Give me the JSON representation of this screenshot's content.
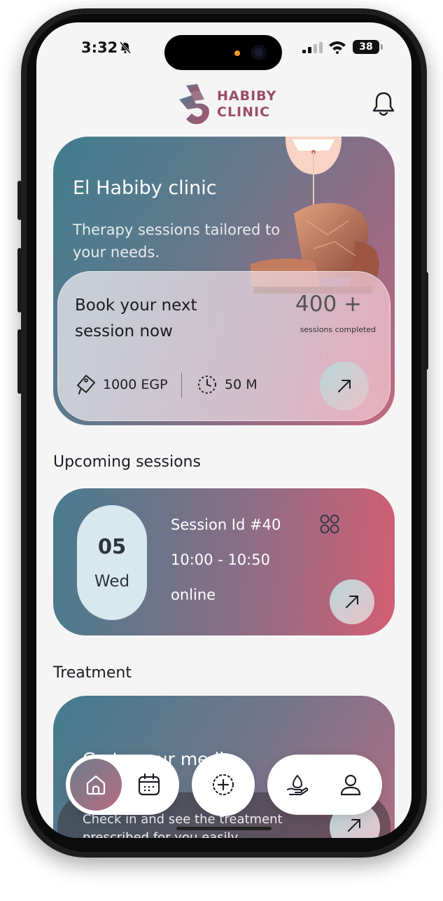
{
  "status_bar": {
    "time": "3:32",
    "battery": "38"
  },
  "header": {
    "logo_line1": "HABIBY",
    "logo_line2": "CLINIC"
  },
  "hero": {
    "title": "El Habiby clinic",
    "subtitle": "Therapy sessions tailored to your needs.",
    "cta": "Book your next session now",
    "count": "400 +",
    "count_label": "sessions completed",
    "price": "1000 EGP",
    "duration": "50 M"
  },
  "upcoming": {
    "section_title": "Upcoming sessions",
    "day": "05",
    "weekday": "Wed",
    "session_id": "Session Id #40",
    "time": "10:00 - 10:50",
    "mode": "online"
  },
  "treatment": {
    "section_title": "Treatment",
    "card_title": "Go to your medi",
    "card_sub": "Check in and see the treatment prescribed for you easily"
  },
  "bottom_nav": {
    "items": [
      "home-icon",
      "calendar-icon",
      "add-icon",
      "care-icon",
      "profile-icon"
    ]
  },
  "colors": {
    "brand": "#9b4f62",
    "teal": "#3f7d8e",
    "rose": "#d35e74"
  }
}
